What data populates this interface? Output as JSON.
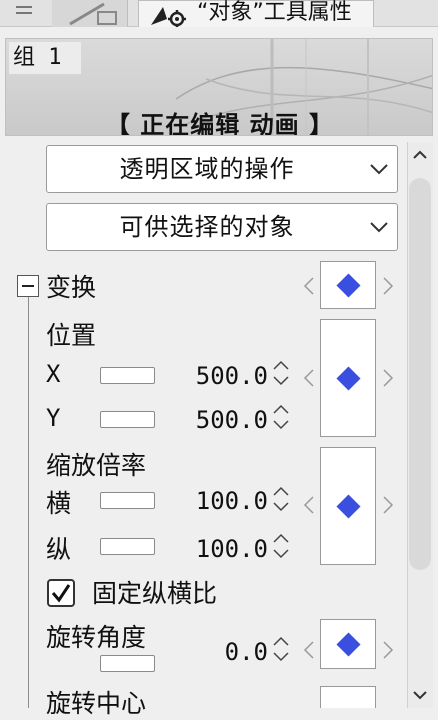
{
  "tabs": {
    "active_title": "“对象”工具属性"
  },
  "preview": {
    "group_name": "组 1",
    "editing_label": "【 正在编辑 动画 】"
  },
  "dropdowns": [
    {
      "value": "透明区域的操作"
    },
    {
      "value": "可供选择的对象"
    }
  ],
  "transform": {
    "section_label": "变换",
    "position": {
      "label": "位置",
      "x_label": "X",
      "x_value": "500.0",
      "y_label": "Y",
      "y_value": "500.0"
    },
    "scale": {
      "label": "缩放倍率",
      "h_label": "横",
      "h_value": "100.0",
      "v_label": "纵",
      "v_value": "100.0"
    },
    "keep_ratio": {
      "label": "固定纵横比",
      "checked": true
    },
    "rotation": {
      "label": "旋转角度",
      "value": "0.0"
    },
    "rotation_center": {
      "label": "旋转中心"
    }
  },
  "colors": {
    "keyframe": "#3a4fe0"
  },
  "icons": [
    "menu-icon",
    "pen-tool-icon",
    "object-tool-icon",
    "chevron-down-icon",
    "chevron-left-icon",
    "chevron-right-icon",
    "keyframe-diamond-icon",
    "stepper-icon",
    "checkmark-icon",
    "collapse-minus-icon",
    "scroll-up-icon",
    "scroll-down-icon"
  ]
}
